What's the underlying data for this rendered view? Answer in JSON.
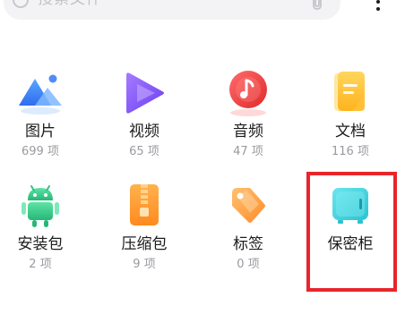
{
  "search": {
    "placeholder": "搜索文件"
  },
  "categories": [
    {
      "label": "图片",
      "count": "699 项",
      "icon": "image-icon"
    },
    {
      "label": "视频",
      "count": "65 项",
      "icon": "video-icon"
    },
    {
      "label": "音频",
      "count": "47 项",
      "icon": "audio-icon"
    },
    {
      "label": "文档",
      "count": "116 项",
      "icon": "document-icon"
    },
    {
      "label": "安装包",
      "count": "2 项",
      "icon": "android-icon"
    },
    {
      "label": "压缩包",
      "count": "9 项",
      "icon": "zip-icon"
    },
    {
      "label": "标签",
      "count": "0 项",
      "icon": "tag-icon"
    },
    {
      "label": "保密柜",
      "count": "",
      "icon": "safe-icon"
    }
  ],
  "colors": {
    "highlight": "#e8252b",
    "image_blue": "#3d8bff",
    "video_purple": "#8b5cf6",
    "audio_red": "#f04444",
    "doc_yellow": "#ffc53d",
    "android_green": "#3fcf8e",
    "zip_orange": "#ff9a2e",
    "tag_orange": "#ff9d3a",
    "safe_cyan": "#3fd6e0"
  }
}
